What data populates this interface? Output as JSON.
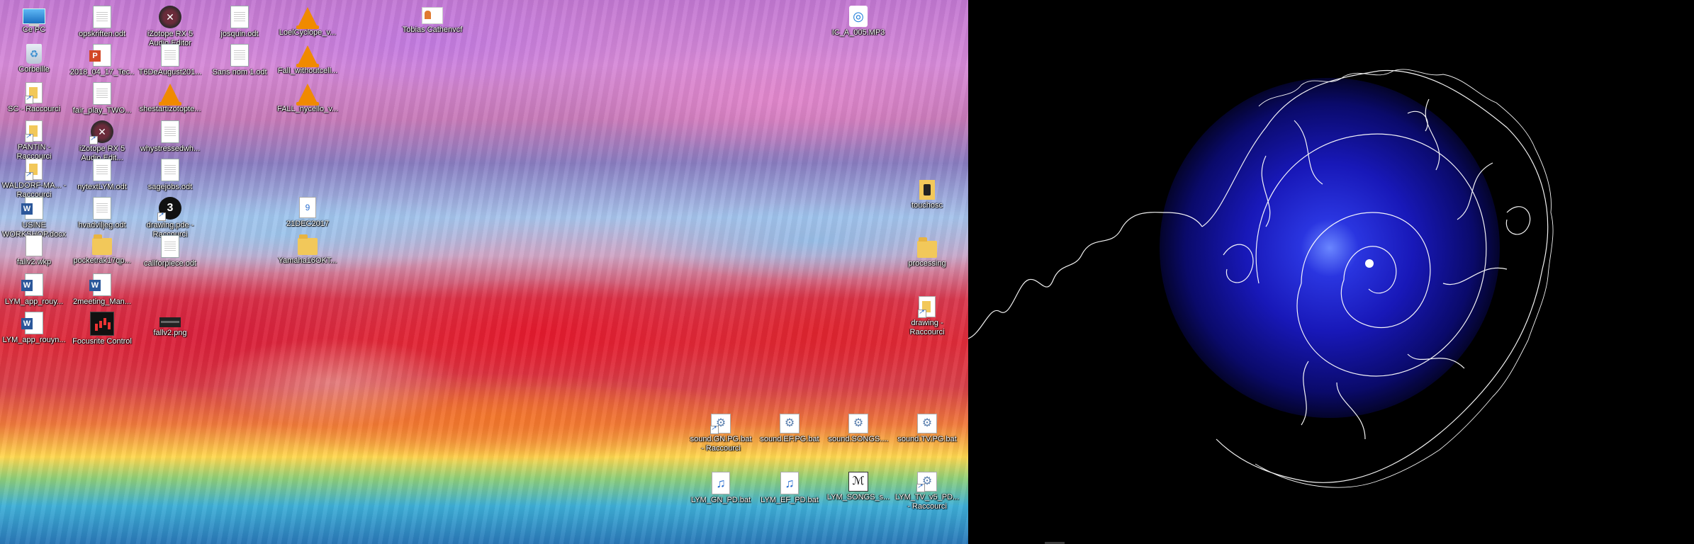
{
  "desktop_left": {
    "icons": [
      {
        "label": "Ce PC",
        "icon": "computer-icon"
      },
      {
        "label": "Corbeille",
        "icon": "recycle-bin-icon"
      },
      {
        "label": "SC - Raccourci",
        "icon": "folder-shortcut-icon"
      },
      {
        "label": "PANTIN - Raccourci",
        "icon": "folder-shortcut-icon"
      },
      {
        "label": "WALDORF-MA... - Raccourci",
        "icon": "document-shortcut-icon"
      },
      {
        "label": "USINE WORKSHOP.docx",
        "icon": "word-document-icon"
      },
      {
        "label": "fallv2.wkp",
        "icon": "file-icon"
      },
      {
        "label": "LYM_app_rouy...",
        "icon": "word-document-icon"
      },
      {
        "label": "LYM_app_rouyn...",
        "icon": "word-document-icon"
      },
      {
        "label": "opskriften.odt",
        "icon": "document-icon"
      },
      {
        "label": "2018_04_17_Tec...",
        "icon": "powerpoint-icon"
      },
      {
        "label": "fair_play_TWO...",
        "icon": "document-icon"
      },
      {
        "label": "iZotope RX 5 Audio Edit...",
        "icon": "izotope-icon"
      },
      {
        "label": "nytextLYM.odt",
        "icon": "document-icon"
      },
      {
        "label": "hvadviljeg.odt",
        "icon": "document-icon"
      },
      {
        "label": "pocketrak17qp...",
        "icon": "folder-icon"
      },
      {
        "label": "2meeting_Man...",
        "icon": "word-document-icon"
      },
      {
        "label": "Focusrite Control",
        "icon": "focusrite-icon"
      },
      {
        "label": "iZotope RX 5 Audio Editor",
        "icon": "izotope-icon"
      },
      {
        "label": "T6DeAugust201...",
        "icon": "document-icon"
      },
      {
        "label": "shestartizotopte...",
        "icon": "vlc-icon"
      },
      {
        "label": "whystressedwh...",
        "icon": "document-icon"
      },
      {
        "label": "sagejobs.odt",
        "icon": "document-icon"
      },
      {
        "label": "drawing.pde - Raccourci",
        "icon": "processing-icon"
      },
      {
        "label": "callforpiece.odt",
        "icon": "document-icon"
      },
      {
        "label": "fallv2.png",
        "icon": "image-icon"
      },
      {
        "label": "josquin.odt",
        "icon": "document-icon"
      },
      {
        "label": "Sans nom 1.odt",
        "icon": "document-icon"
      },
      {
        "label": "LoelCyclope_v...",
        "icon": "vlc-icon"
      },
      {
        "label": "Fall_withoutcell...",
        "icon": "vlc-icon"
      },
      {
        "label": "FALL_nycello_v...",
        "icon": "vlc-icon"
      },
      {
        "label": "21DEC2017",
        "icon": "calendar-file-icon"
      },
      {
        "label": "Yamaha16OKT...",
        "icon": "folder-icon"
      },
      {
        "label": "Tobias Cathenvcf",
        "icon": "contact-card-icon"
      },
      {
        "label": "IC_A_005.MP3",
        "icon": "audio-file-icon"
      },
      {
        "label": "touchosc",
        "icon": "touchosc-icon"
      },
      {
        "label": "processing",
        "icon": "folder-icon"
      },
      {
        "label": "drawing - Raccourci",
        "icon": "document-shortcut-icon"
      },
      {
        "label": "sound.GN.PG.bat - Raccourci",
        "icon": "batch-file-icon"
      },
      {
        "label": "sound.EF.PG.bat",
        "icon": "batch-file-icon"
      },
      {
        "label": "sound.SONGS....",
        "icon": "batch-file-icon"
      },
      {
        "label": "sound.TV.PG.bat",
        "icon": "batch-file-icon"
      },
      {
        "label": "LYM_GN_PD.bat",
        "icon": "audio-batch-icon"
      },
      {
        "label": "LYM_EF_PD.bat",
        "icon": "audio-batch-icon"
      },
      {
        "label": "LYM_SONGS_s...",
        "icon": "songs-file-icon"
      },
      {
        "label": "LYM_TV_v5_PD... - Raccourci",
        "icon": "batch-file-icon"
      }
    ]
  },
  "desktop_right": {
    "wallpaper": "blue-spiral-artwork",
    "colors": {
      "line": "#ffffff",
      "glow_core": "#6a86ff",
      "glow_mid": "#1818b8",
      "background": "#000000"
    }
  }
}
